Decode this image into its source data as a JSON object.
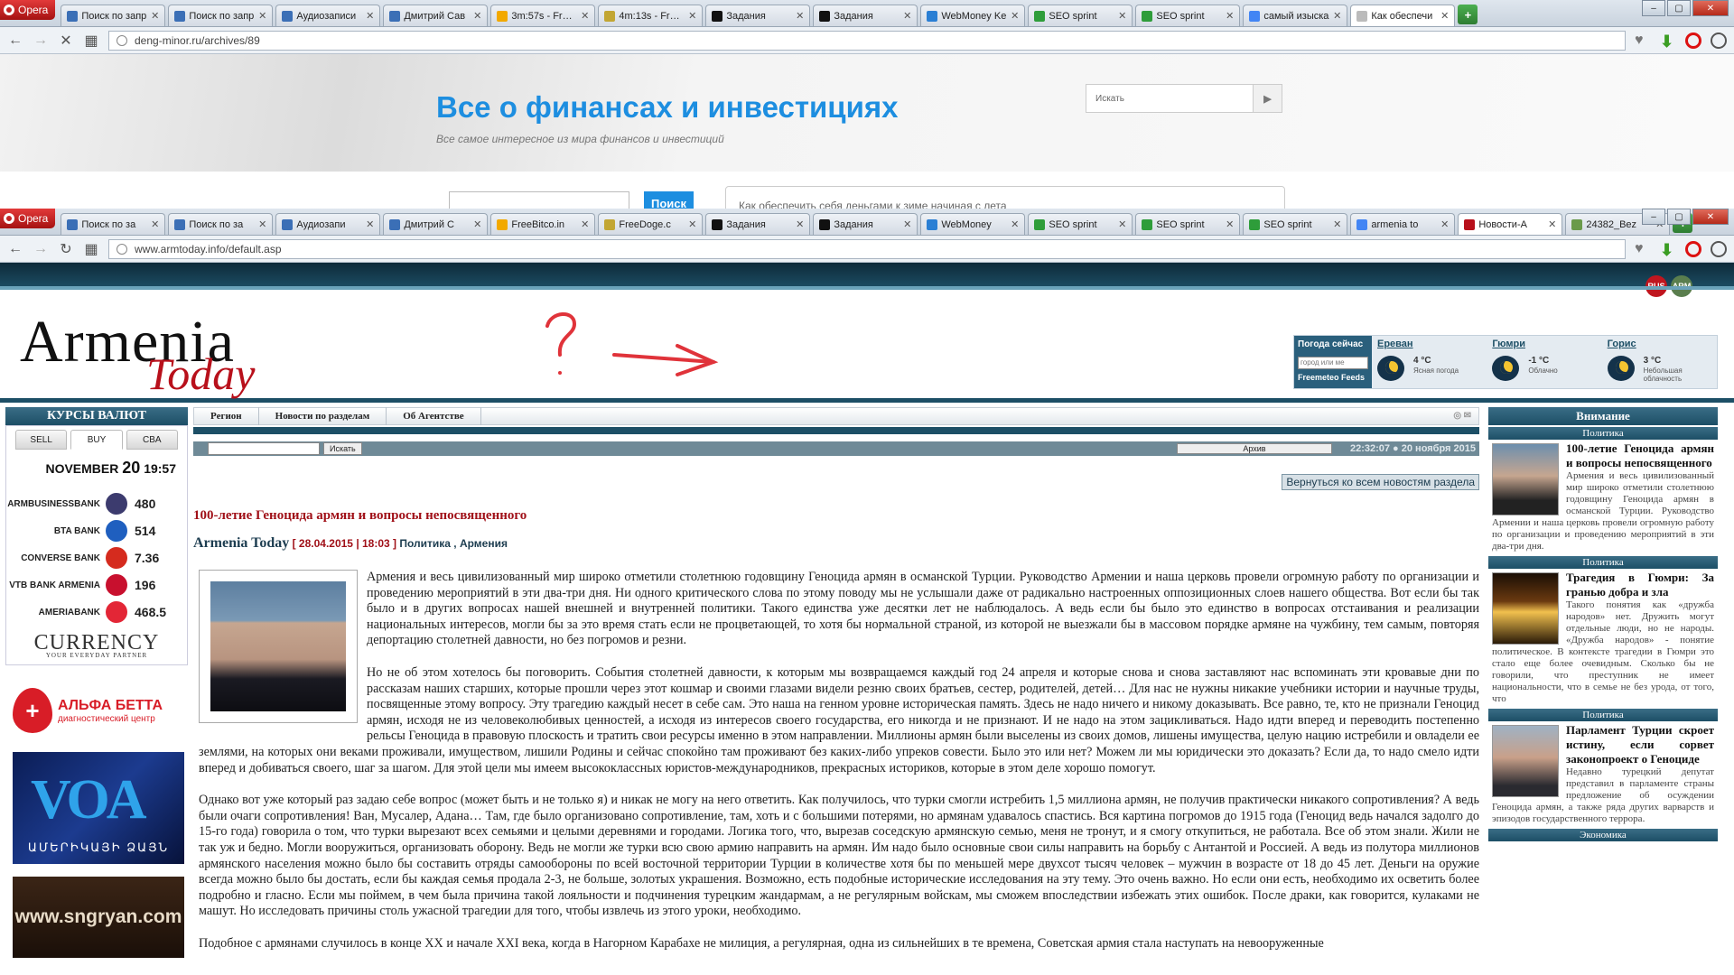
{
  "window1": {
    "opera_label": "Opera",
    "tabs": [
      {
        "label": "Поиск по запр",
        "fav": "#3b6fb6"
      },
      {
        "label": "Поиск по запр",
        "fav": "#3b6fb6"
      },
      {
        "label": "Аудиозаписи",
        "fav": "#3b6fb6"
      },
      {
        "label": "Дмитрий Сав",
        "fav": "#3b6fb6"
      },
      {
        "label": "3m:57s - FreeB",
        "fav": "#f2a900"
      },
      {
        "label": "4m:13s - FreeD",
        "fav": "#c2a633"
      },
      {
        "label": "Задания",
        "fav": "#111111"
      },
      {
        "label": "Задания",
        "fav": "#111111"
      },
      {
        "label": "WebMoney Ke",
        "fav": "#2a7fd4"
      },
      {
        "label": "SEO sprint",
        "fav": "#2e9d3a"
      },
      {
        "label": "SEO sprint",
        "fav": "#2e9d3a"
      },
      {
        "label": "самый изыска",
        "fav": "#4285f4"
      },
      {
        "label": "Как обеспечи",
        "fav": "#bbbbbb"
      }
    ],
    "url": "deng-minor.ru/archives/89"
  },
  "page1": {
    "title": "Все о финансах и инвестициях",
    "subtitle": "Все самое интересное из мира финансов и инвестиций",
    "search_placeholder": "Искать",
    "search_button": "Поиск",
    "ticker": "Как обеспечить себя деньгами к зиме начиная с лета"
  },
  "window2": {
    "opera_label": "Opera",
    "tabs": [
      {
        "label": "Поиск по за",
        "fav": "#3b6fb6"
      },
      {
        "label": "Поиск по за",
        "fav": "#3b6fb6"
      },
      {
        "label": "Аудиозапи",
        "fav": "#3b6fb6"
      },
      {
        "label": "Дмитрий С",
        "fav": "#3b6fb6"
      },
      {
        "label": "FreeBitco.in",
        "fav": "#f2a900"
      },
      {
        "label": "FreeDoge.c",
        "fav": "#c2a633"
      },
      {
        "label": "Задания",
        "fav": "#111111"
      },
      {
        "label": "Задания",
        "fav": "#111111"
      },
      {
        "label": "WebMoney",
        "fav": "#2a7fd4"
      },
      {
        "label": "SEO sprint",
        "fav": "#2e9d3a"
      },
      {
        "label": "SEO sprint",
        "fav": "#2e9d3a"
      },
      {
        "label": "SEO sprint",
        "fav": "#2e9d3a"
      },
      {
        "label": "armenia to",
        "fav": "#4285f4"
      },
      {
        "label": "Новости-А",
        "fav": "#b8101b"
      },
      {
        "label": "24382_Bez",
        "fav": "#6a9a4a"
      }
    ],
    "url": "www.armtoday.info/default.asp"
  },
  "site": {
    "lang_rus": "RUS",
    "lang_arm": "ARM",
    "logo_main": "Armenia",
    "logo_sub": "Today",
    "weather": {
      "now_label": "Погода сейчас",
      "input_placeholder": "город или ме",
      "feeds": "Freemeteo Feeds",
      "cities": [
        {
          "name": "Ереван",
          "temp": "4 °C",
          "cond": "Ясная погода"
        },
        {
          "name": "Гюмри",
          "temp": "-1 °C",
          "cond": "Облачно"
        },
        {
          "name": "Горис",
          "temp": "3 °C",
          "cond": "Небольшая облачность"
        }
      ]
    },
    "currency": {
      "header": "КУРСЫ ВАЛЮТ",
      "tabs": [
        "SELL",
        "BUY",
        "CBA"
      ],
      "date_month": "NOVEMBER",
      "date_day": "20",
      "date_time": "19:57",
      "rows": [
        {
          "bank": "ARMBUSINESSBANK",
          "value": "480",
          "flag": "#3c3b6e"
        },
        {
          "bank": "BTA BANK",
          "value": "514",
          "flag": "#1f5fbf"
        },
        {
          "bank": "CONVERSE BANK",
          "value": "7.36",
          "flag": "#d52b1e"
        },
        {
          "bank": "VTB BANK ARMENIA",
          "value": "196",
          "flag": "#c8102e"
        },
        {
          "bank": "AMERIABANK",
          "value": "468.5",
          "flag": "#e32636"
        }
      ],
      "brand": "CURRENCY",
      "brand_sub": "YOUR EVERYDAY PARTNER"
    },
    "ads": {
      "alfa_title": "АЛЬФА БЕТТА",
      "alfa_sub": "диагностический центр",
      "voa_letters": "VOA",
      "voa_sub": "ԱՄԵՐԻԿԱՅԻ ՁԱՅՆ",
      "sngryan": "www.sngryan.com"
    },
    "nav": [
      "Регион",
      "Новости по разделам",
      "Об Агентстве"
    ],
    "search_button": "Искать",
    "archive": "Архив",
    "datetime": "22:32:07 ● 20 ноября 2015",
    "back_button": "Вернуться ко всем новостям раздела"
  },
  "article": {
    "title": "100-летие Геноцида армян и вопросы непосвященного",
    "source": "Armenia Today",
    "date": "[ 28.04.2015 | 18:03 ]",
    "category": "Политика , Армения",
    "paragraphs": [
      "Армения и весь цивилизованный мир широко отметили столетнюю годовщину Геноцида армян в османской Турции. Руководство Армении и наша церковь провели огромную работу по организации и проведению мероприятий в эти два-три дня. Ни одного критического слова по этому поводу мы не услышали даже от радикально настроенных оппозиционных слоев нашего общества. Вот если бы так было и в других вопросах нашей внешней и внутренней политики. Такого единства уже десятки лет не наблюдалось. А ведь если бы было это единство в вопросах отстаивания и реализации национальных интересов, могли бы за это время стать если не процветающей, то хотя бы нормальной страной, из которой не выезжали бы в массовом порядке армяне на чужбину, тем самым, повторяя депортацию столетней давности, но без погромов и резни.",
      "Но не об этом хотелось бы поговорить. События столетней давности, к которым мы возвращаемся каждый год 24 апреля и которые снова и снова заставляют нас вспоминать эти кровавые дни по рассказам наших старших, которые прошли через этот кошмар и своими глазами видели резню своих братьев, сестер, родителей, детей… Для нас не нужны никакие учебники истории и научные труды, посвященные этому вопросу. Эту трагедию каждый несет в себе сам. Это нашa на генном уровне историческая память. Здесь не надо ничего и никому доказывать. Все равно, те, кто не признали Геноцид армян, исходя не из человеколюбивых ценностей, а исходя из интересов своего государства, его никогда и не признают. И не надо на этом зацикливаться. Надо идти вперед и переводить постепенно рельсы Геноцида в правовую плоскость и  тратить свои ресурсы именно в этом направлении. Миллионы армян были выселены из своих домов, лишены имущества, целую нацию истребили и овладели ее землями, на которых они веками проживали, имуществом, лишили Родины и сейчас спокойно там проживают без каких-либо упреков совести. Было это или нет? Можем ли мы юридически это доказать? Если да, то надо смело идти вперед и добиваться своего, шаг за шагом. Для этой цели мы имеем высококлассных юристов-международников, прекрасных историков, которые в этом деле хорошо помогут.",
      "Однако вот уже который раз задаю себе вопрос (может быть и не только я) и никак не могу на него ответить. Как получилось, что турки смогли истребить 1,5 миллиона армян, не получив практически никакого сопротивления? А ведь были очаги сопротивления! Ван, Мусалер, Адана… Там, где было организовано сопротивление, там, хоть и с большими потерями, но армянам удавалось спастись. Вся картина погромов до 1915 года (Геноцид ведь начался задолго до 15-го года) говорила о том, что турки вырезают всех семьями и целыми деревнями и городами. Логика того, что, вырезав соседскую армянскую семью, меня не тронут, и я смогу откупиться, не работала. Все об этом знали. Жили не так уж и бедно. Могли вооружиться, организовать оборону. Ведь не могли же турки всю свою армию направить на армян. Им надо было основные свои силы направить на борьбу с Антантой и Россией. А ведь из полутора миллионов армянского населения можно было бы составить отряды самообороны по всей восточной территории Турции в количестве хотя бы по меньшей мере двухсот тысяч человек – мужчин в возрасте от 18 до 45 лет. Деньги на оружие всегда можно было бы достать, если бы каждая семья продала 2-3, не больше, золотых украшения. Возможно, есть подобные  исторические исследования на эту тему. Это очень важно. Но если они есть, необходимо их осветить более подробно и гласно. Если мы поймем, в чем была причина такой лояльности и подчинения турецким жандармам, а не регулярным войскам, мы сможем впоследствии избежать этих ошибок. После драки, как говорится, кулаками не машут. Но исследовать причины столь ужасной трагедии для того, чтобы извлечь из этого уроки, необходимо.",
      "Подобное с армянами случилось в конце XX и начале XXI века, когда в Нагорном Карабахе не милиция, а регулярная, одна из сильнейших в те времена, Советская армия стала наступать на невооруженные"
    ]
  },
  "sidebar": {
    "header": "Внимание",
    "items": [
      {
        "cat": "Политика",
        "title": "100-летие Геноцида армян и вопросы непосвященного",
        "text": "Армения и весь цивилизованный мир широко отметили столетнюю годовщину Геноцида армян в османской Турции. Руководство Армении и наша церковь провели огромную работу по организации и проведению мероприятий в эти два-три дня."
      },
      {
        "cat": "Политика",
        "title": "Трагедия в Гюмри: За гранью добра и зла",
        "text": "Такого понятия как «дружба народов» нет. Дружить могут отдельные люди, но не народы. «Дружба народов» - понятие политическое. В контексте трагедии в Гюмри это стало еще более очевидным. Сколько бы не говорили, что преступник не имеет национальности, что в семье не без урода, от того, что"
      },
      {
        "cat": "Политика",
        "title": "Парламент Турции скроет истину, если сорвет законопроект о Геноциде",
        "text": "Недавно турецкий депутат представил в парламенте страны предложение об осуждении Геноцида армян, а также ряда других варварств и эпизодов государственного террора."
      },
      {
        "cat": "Экономика",
        "title": "",
        "text": ""
      }
    ]
  }
}
